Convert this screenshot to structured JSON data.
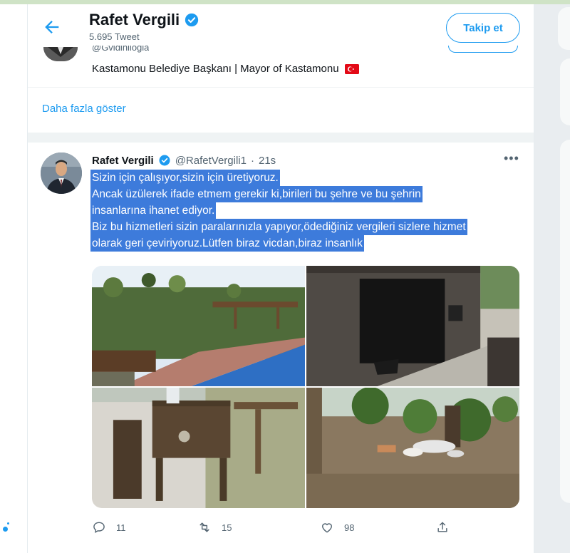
{
  "header": {
    "display_name": "Rafet Vergili",
    "tweet_count": "5.695 Tweet",
    "follow_label": "Takip et"
  },
  "bio": {
    "cut_handle": "@Gvidinliogla",
    "text": "Kastamonu Belediye Başkanı | Mayor of Kastamonu"
  },
  "show_more": "Daha fazla göster",
  "tweet": {
    "name": "Rafet Vergili",
    "handle": "@RafetVergili1",
    "separator": "·",
    "time": "21s",
    "more": "•••",
    "lines": [
      "Sizin için çalışıyor,sizin için üretiyoruz.",
      "Ancak üzülerek ifade etmem gerekir ki,birileri bu şehre ve bu şehrin",
      "insanlarına ihanet ediyor.",
      "Biz bu hizmetleri sizin paralarınızla yapıyor,ödediğiniz vergileri sizlere hizmet",
      "olarak geri çeviriyoruz.Lütfen biraz vicdan,biraz insanlık"
    ],
    "replies": "11",
    "retweets": "15",
    "likes": "98"
  },
  "colors": {
    "accent": "#1d9bf0",
    "selection": "#3d7bdb",
    "flag_red": "#e30a17"
  }
}
